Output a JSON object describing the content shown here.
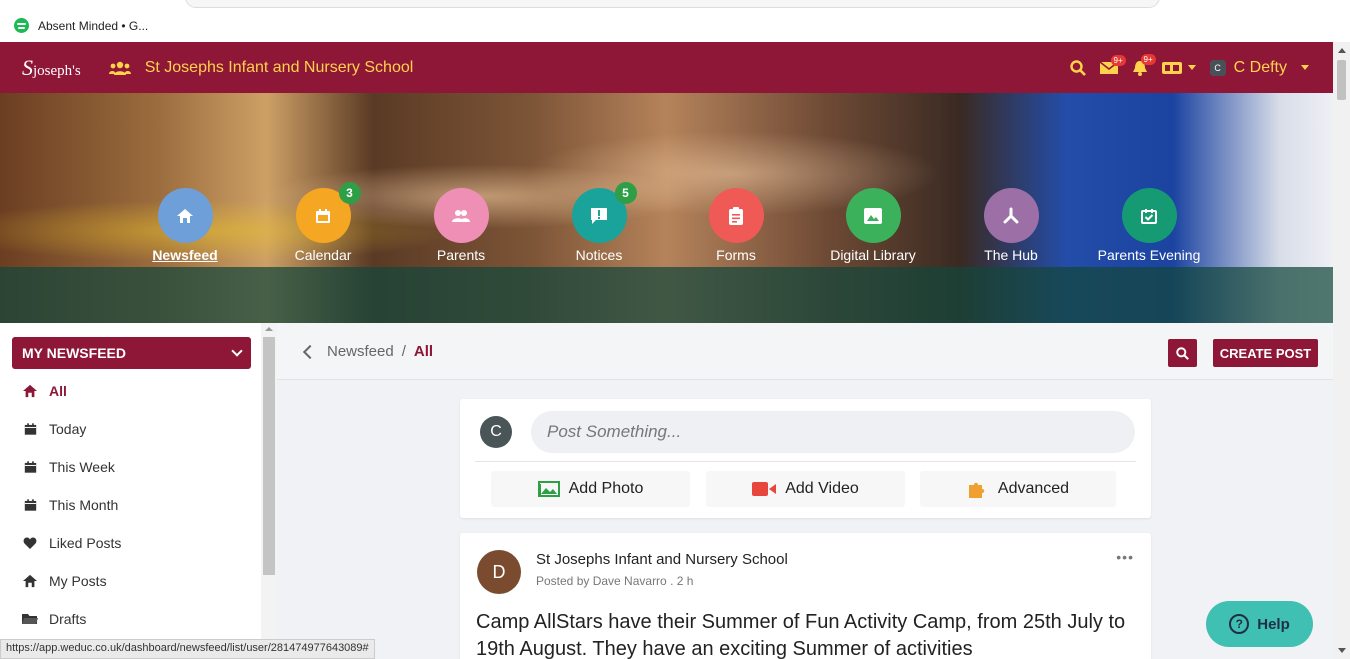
{
  "browser": {
    "bookmark_label": "Absent Minded • G...",
    "status_url": "https://app.weduc.co.uk/dashboard/newsfeed/list/user/281474977643089#"
  },
  "topbar": {
    "logo_s": "S",
    "logo_rest": "joseph's",
    "school_name": "St Josephs Infant and Nursery School",
    "mail_badge": "9+",
    "bell_badge": "9+",
    "user_initial": "C",
    "user_name": "C Defty",
    "accent": "#8e1637",
    "highlight": "#ffd24c"
  },
  "nav": [
    {
      "label": "Newsfeed",
      "color": "#6f9fd8",
      "icon": "home-icon",
      "badge": ""
    },
    {
      "label": "Calendar",
      "color": "#f5a623",
      "icon": "calendar-icon",
      "badge": "3"
    },
    {
      "label": "Parents",
      "color": "#ef8fb6",
      "icon": "people-icon",
      "badge": ""
    },
    {
      "label": "Notices",
      "color": "#1aa39a",
      "icon": "notice-icon",
      "badge": "5"
    },
    {
      "label": "Forms",
      "color": "#ef5a56",
      "icon": "clipboard-icon",
      "badge": ""
    },
    {
      "label": "Digital Library",
      "color": "#3cb15b",
      "icon": "image-icon",
      "badge": ""
    },
    {
      "label": "The Hub",
      "color": "#9c6fa7",
      "icon": "hub-icon",
      "badge": ""
    },
    {
      "label": "Parents Evening",
      "color": "#159a73",
      "icon": "calendar-check-icon",
      "badge": ""
    }
  ],
  "sidebar": {
    "title": "MY NEWSFEED",
    "items": [
      {
        "label": "All",
        "icon": "home-icon"
      },
      {
        "label": "Today",
        "icon": "calendar-icon"
      },
      {
        "label": "This Week",
        "icon": "calendar-icon"
      },
      {
        "label": "This Month",
        "icon": "calendar-icon"
      },
      {
        "label": "Liked Posts",
        "icon": "heart-icon"
      },
      {
        "label": "My Posts",
        "icon": "home-icon"
      },
      {
        "label": "Drafts",
        "icon": "folder-icon"
      }
    ]
  },
  "breadcrumb": {
    "parent": "Newsfeed",
    "separator": "/",
    "current": "All"
  },
  "actions": {
    "create_post": "CREATE POST"
  },
  "composer": {
    "avatar": "C",
    "placeholder": "Post Something...",
    "add_photo": "Add Photo",
    "add_video": "Add Video",
    "advanced": "Advanced"
  },
  "post": {
    "avatar": "D",
    "author_org": "St Josephs Infant and Nursery School",
    "meta": "Posted by Dave Navarro . 2 h",
    "body": "Camp AllStars have their Summer of Fun Activity Camp, from 25th July to 19th August. They have an exciting Summer of activities"
  },
  "help": {
    "label": "Help"
  }
}
